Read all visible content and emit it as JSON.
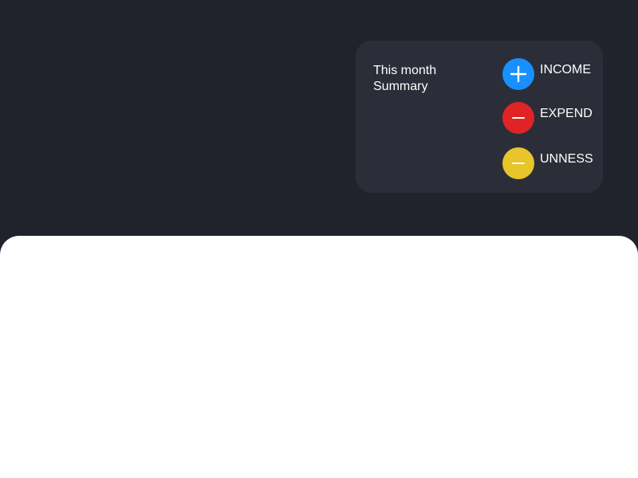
{
  "summary": {
    "title": "This month\nSummary",
    "items": [
      {
        "label": "INCOME",
        "icon": "plus-icon",
        "color": "#1890ff"
      },
      {
        "label": "EXPEND",
        "icon": "minus-icon",
        "color": "#e02424"
      },
      {
        "label": "UNNESS",
        "icon": "minus-icon",
        "color": "#e8c52b"
      }
    ]
  },
  "colors": {
    "background": "#20232b",
    "card": "#2b2e38",
    "sheet": "#ffffff"
  }
}
